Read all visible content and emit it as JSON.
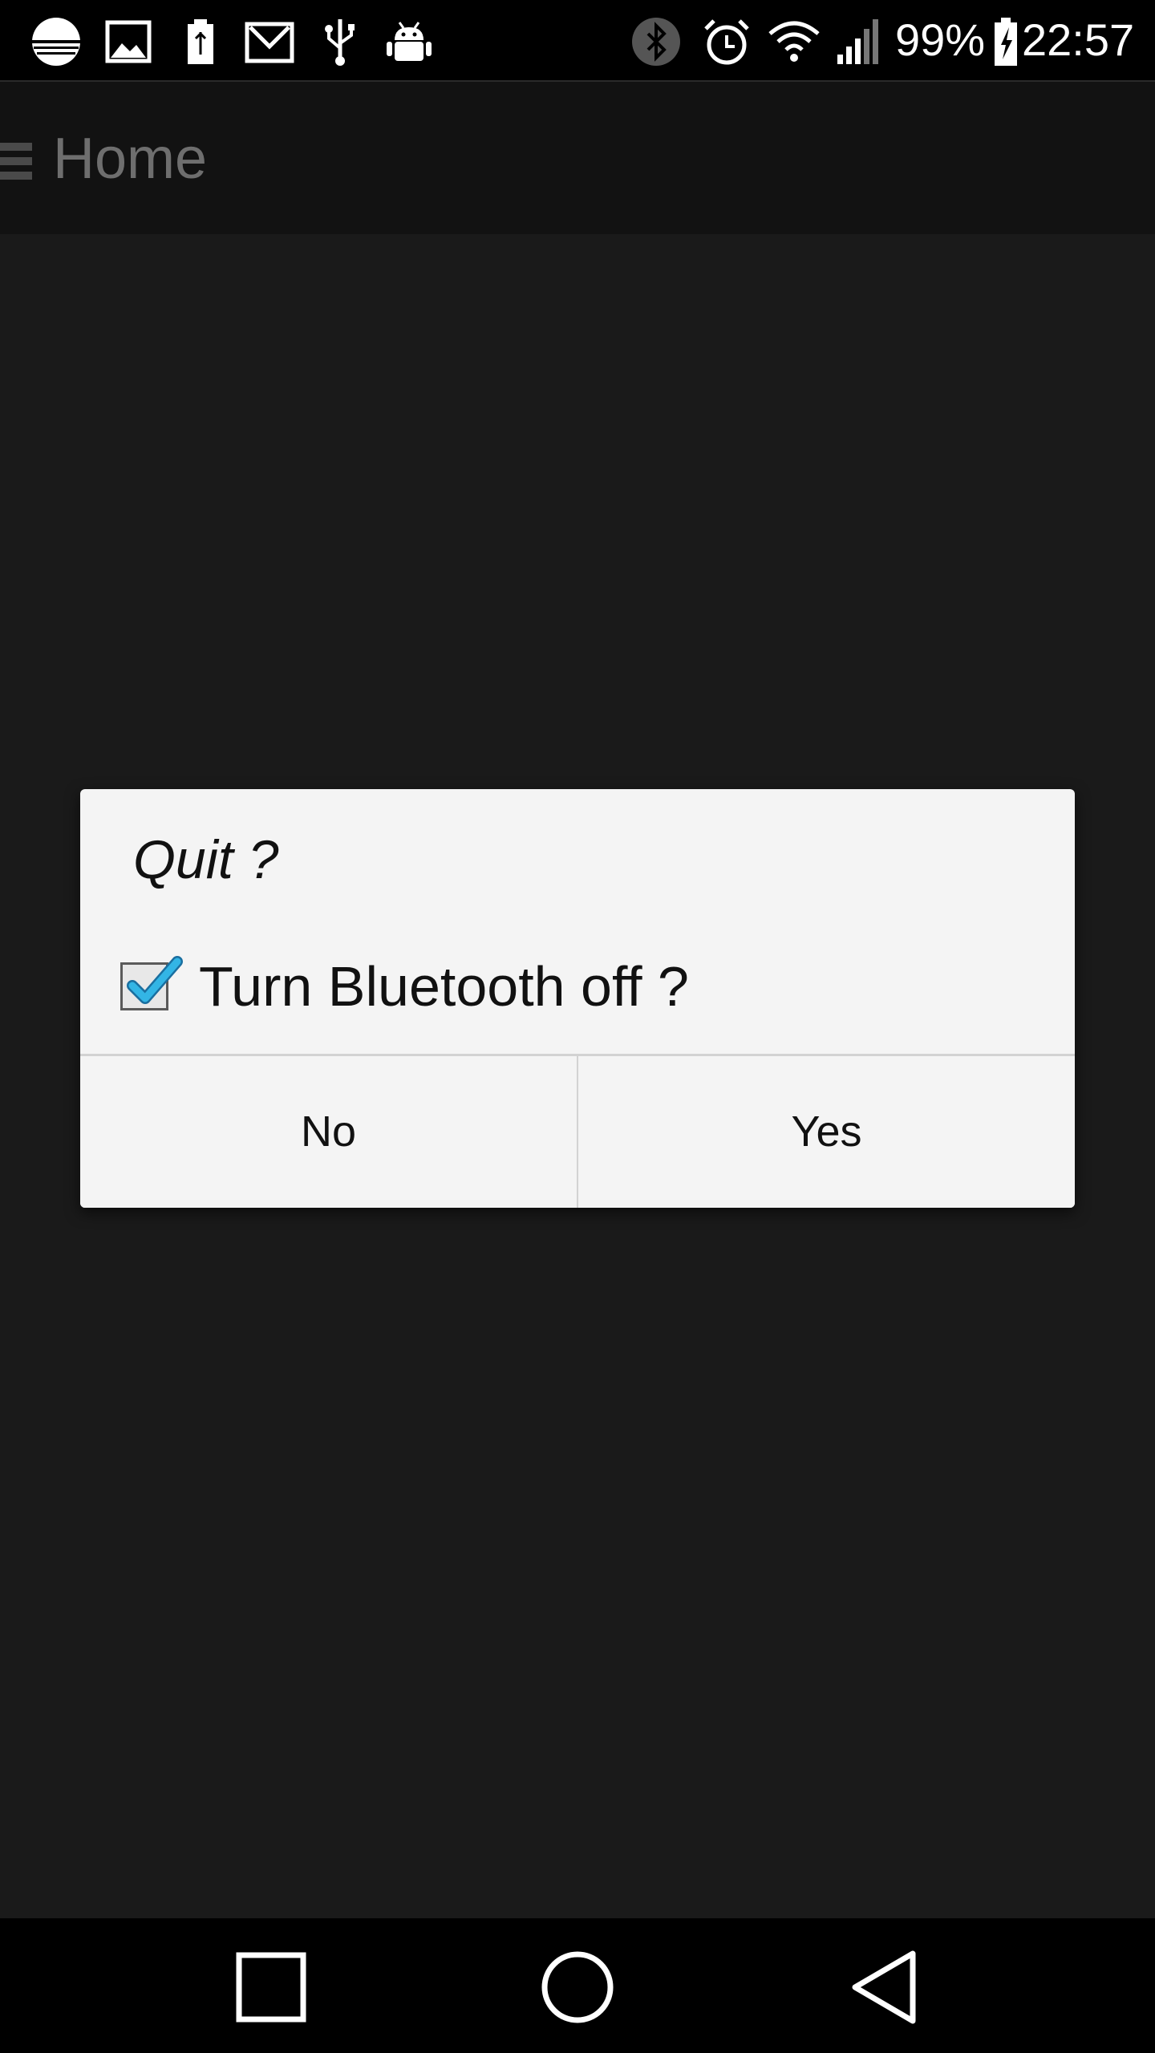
{
  "status_bar": {
    "battery_percent": "99%",
    "time": "22:57",
    "left_icons": [
      "app-icon",
      "image-icon",
      "battery-saver-icon",
      "gmail-icon",
      "usb-icon",
      "android-debug-icon"
    ],
    "right_icons": [
      "bluetooth-icon",
      "alarm-icon",
      "wifi-icon",
      "signal-icon",
      "battery-charging-icon"
    ]
  },
  "action_bar": {
    "title": "Home",
    "menu_icon": "hamburger-menu-icon"
  },
  "dialog": {
    "title": "Quit ?",
    "checkbox_label": "Turn Bluetooth off ?",
    "checkbox_checked": true,
    "no_label": "No",
    "yes_label": "Yes"
  },
  "nav_bar": {
    "buttons": [
      "recents-icon",
      "home-icon",
      "back-icon"
    ]
  },
  "colors": {
    "background": "#1a1a1a",
    "status_bar": "#000000",
    "action_bar": "#121212",
    "dialog": "#f4f4f4",
    "checkmark": "#33b5e5"
  }
}
